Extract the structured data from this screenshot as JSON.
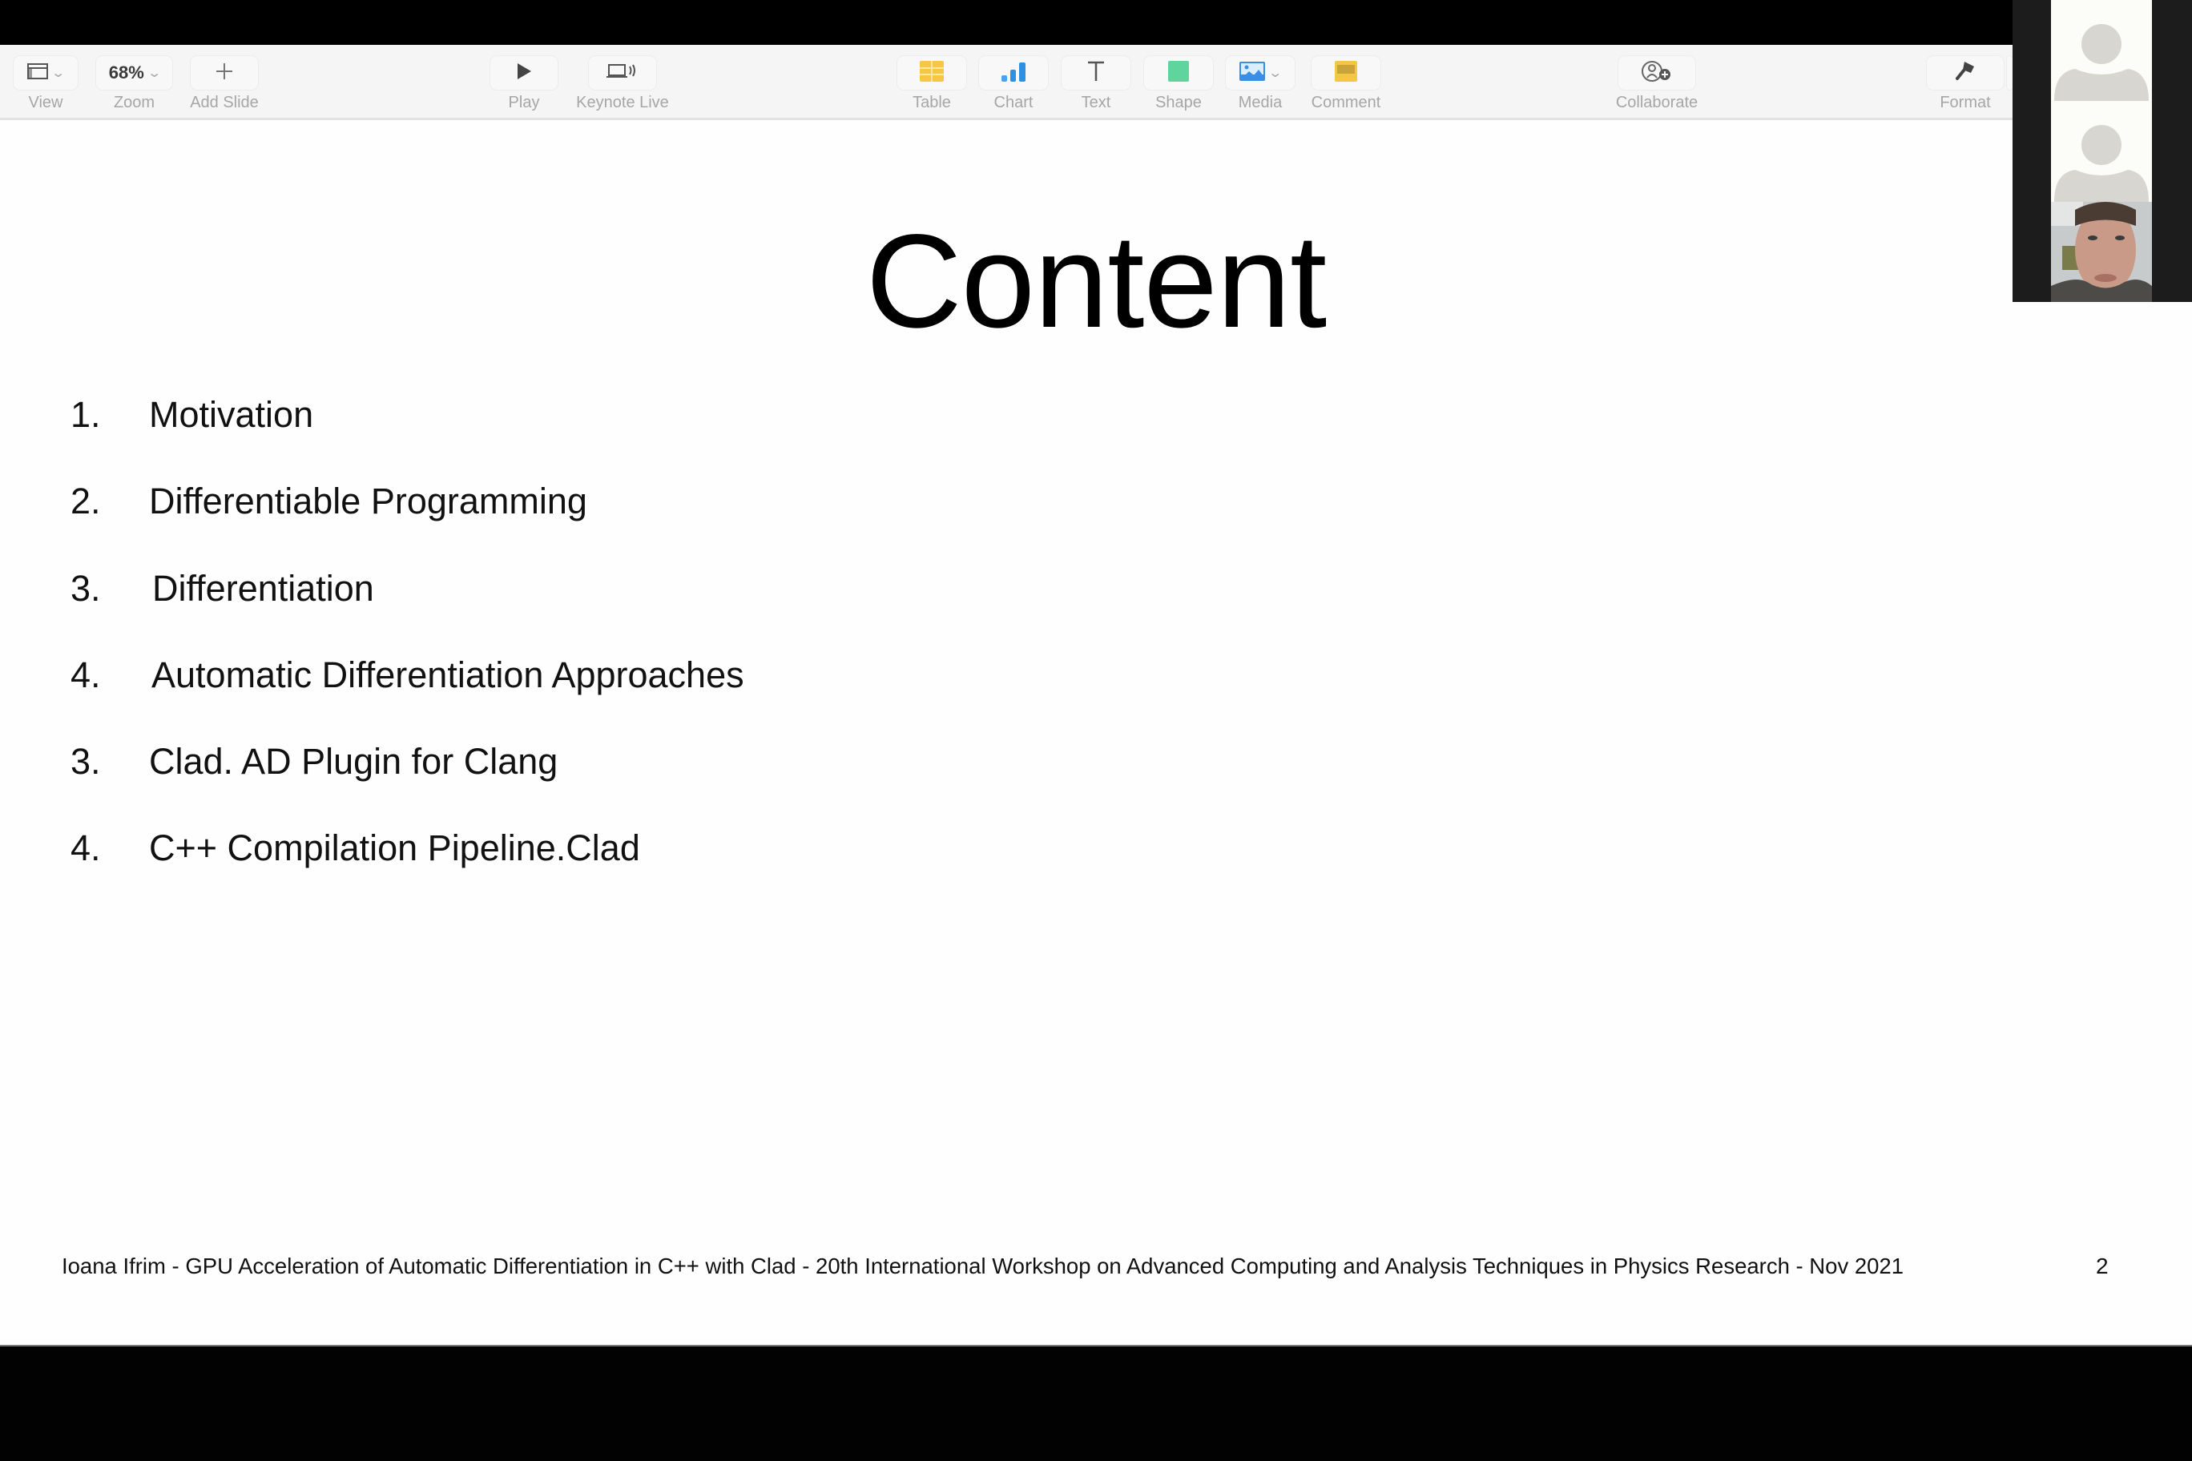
{
  "toolbar": {
    "view": {
      "label": "View",
      "icon": "sidebar-layout-icon"
    },
    "zoom": {
      "label": "Zoom",
      "value": "68%"
    },
    "add_slide": {
      "label": "Add Slide",
      "icon": "plus-icon"
    },
    "play": {
      "label": "Play",
      "icon": "play-icon"
    },
    "keynote_live": {
      "label": "Keynote Live",
      "icon": "broadcast-laptop-icon"
    },
    "table": {
      "label": "Table",
      "icon": "table-icon",
      "color": "#f5c842"
    },
    "chart": {
      "label": "Chart",
      "icon": "bar-chart-icon",
      "color": "#2f8fe0"
    },
    "text": {
      "label": "Text",
      "icon": "text-icon"
    },
    "shape": {
      "label": "Shape",
      "icon": "square-shape-icon",
      "color": "#5fd49c"
    },
    "media": {
      "label": "Media",
      "icon": "image-icon",
      "color": "#3a8ee6"
    },
    "comment": {
      "label": "Comment",
      "icon": "comment-note-icon",
      "color": "#f2c744"
    },
    "collaborate": {
      "label": "Collaborate",
      "icon": "add-person-icon"
    },
    "format": {
      "label": "Format",
      "icon": "paintbrush-icon"
    }
  },
  "slide": {
    "title": "Content",
    "items": [
      {
        "number": "1.",
        "text": "Motivation"
      },
      {
        "number": "2.",
        "text": "Differentiable Programming"
      },
      {
        "number": "3.",
        "text": "Differentiation"
      },
      {
        "number": "4.",
        "text": "Automatic Differentiation Approaches"
      },
      {
        "number": "3.",
        "text": "Clad. AD Plugin for Clang"
      },
      {
        "number": "4.",
        "text": "C++ Compilation Pipeline.Clad"
      }
    ],
    "footer": "Ioana Ifrim  - GPU Acceleration of Automatic Differentiation in C++ with Clad - 20th International Workshop on Advanced Computing and Analysis Techniques in Physics Research - Nov 2021",
    "page_number": "2"
  },
  "participants": [
    {
      "type": "avatar-placeholder"
    },
    {
      "type": "avatar-placeholder"
    },
    {
      "type": "video"
    }
  ]
}
